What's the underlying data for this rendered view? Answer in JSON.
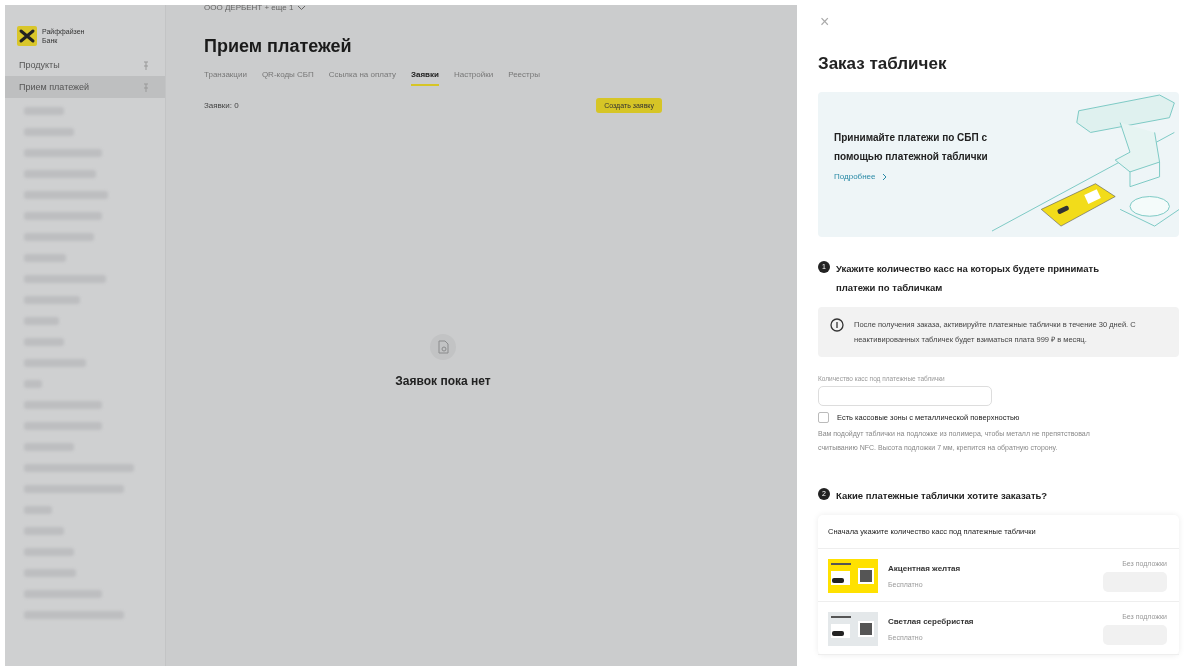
{
  "sidebar": {
    "logo_text": "Райффайзен Банк",
    "items": [
      {
        "label": "Продукты",
        "selected": false
      },
      {
        "label": "Прием платежей",
        "selected": true
      }
    ]
  },
  "header": {
    "company": "ООО ДЕРБЕНТ + еще 1",
    "title": "Прием платежей"
  },
  "tabs": [
    {
      "label": "Транзакции",
      "selected": false
    },
    {
      "label": "QR-коды СБП",
      "selected": false
    },
    {
      "label": "Ссылка на оплату",
      "selected": false
    },
    {
      "label": "Заявки",
      "selected": true
    },
    {
      "label": "Настройки",
      "selected": false
    },
    {
      "label": "Реестры",
      "selected": false
    }
  ],
  "requests": {
    "count_label": "Заявки: 0",
    "create_button": "Создать заявку",
    "empty_text": "Заявок пока нет"
  },
  "panel": {
    "close": "×",
    "title": "Заказ табличек",
    "banner": {
      "text": "Принимайте платежи по СБП с помощью платежной таблички",
      "link": "Подробнее"
    },
    "step1": {
      "number": "1",
      "heading": "Укажите количество касс на которых будете принимать платежи по табличкам",
      "info": "После получения заказа, активируйте платежные таблички в течение 30 дней. С неактивированных табличек будет взиматься плата 999 ₽ в месяц.",
      "field_label": "Количество касс под платежные таблички",
      "checkbox": {
        "label": "Есть кассовые зоны с металлической поверхностью",
        "checked": false
      },
      "hint": "Вам подойдут таблички на подложке из полимера, чтобы металл не препятствовал считыванию NFC. Высота подложки 7 мм, крепится на обратную сторону."
    },
    "step2": {
      "number": "2",
      "heading": "Какие платежные таблички хотите заказать?",
      "card_header": "Сначала укажите количество касс под платежные таблички",
      "plates": [
        {
          "name": "Акцентная желтая",
          "price": "Бесплатно",
          "option_label": "Без подложки",
          "color": "#ffe100"
        },
        {
          "name": "Светлая серебристая",
          "price": "Бесплатно",
          "option_label": "Без подложки",
          "color": "#e4e8ea"
        }
      ]
    }
  }
}
